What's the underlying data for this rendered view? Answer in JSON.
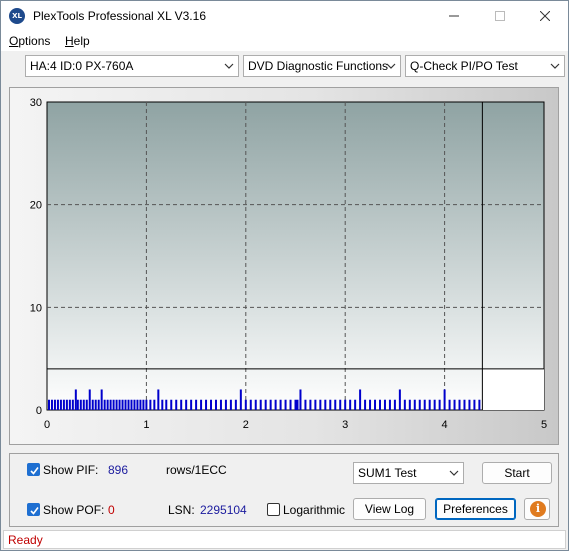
{
  "window": {
    "title": "PlexTools Professional XL V3.16",
    "icon_label": "XL"
  },
  "menu": {
    "items": [
      {
        "label": "Options",
        "accel": "O"
      },
      {
        "label": "Help",
        "accel": "H"
      }
    ]
  },
  "toolbar": {
    "drive": "HA:4 ID:0  PX-760A",
    "function": "DVD Diagnostic Functions",
    "test": "Q-Check PI/PO Test"
  },
  "chart_data": {
    "type": "bar",
    "x_ticks": [
      "0",
      "1",
      "2",
      "3",
      "4",
      "5"
    ],
    "y_ticks": [
      "0",
      "10",
      "20",
      "30"
    ],
    "xlim": [
      0,
      5
    ],
    "ylim": [
      0,
      30
    ],
    "grid": true,
    "threshold_line_y": 4,
    "end_marker_x": 4.38,
    "colors": {
      "bars": "#0000cc",
      "grid": "#555555",
      "plot_top": "#8fa3a3",
      "plot_bottom": "#ffffff"
    },
    "x": [
      0.02,
      0.05,
      0.08,
      0.11,
      0.14,
      0.17,
      0.2,
      0.23,
      0.26,
      0.29,
      0.31,
      0.34,
      0.37,
      0.4,
      0.43,
      0.46,
      0.49,
      0.52,
      0.55,
      0.58,
      0.61,
      0.64,
      0.67,
      0.7,
      0.73,
      0.76,
      0.79,
      0.82,
      0.85,
      0.88,
      0.91,
      0.94,
      0.97,
      1.0,
      1.04,
      1.08,
      1.12,
      1.16,
      1.2,
      1.25,
      1.3,
      1.35,
      1.4,
      1.45,
      1.5,
      1.55,
      1.6,
      1.65,
      1.7,
      1.75,
      1.8,
      1.85,
      1.9,
      1.95,
      2.0,
      2.05,
      2.1,
      2.15,
      2.2,
      2.25,
      2.3,
      2.35,
      2.4,
      2.45,
      2.5,
      2.52,
      2.55,
      2.6,
      2.65,
      2.7,
      2.75,
      2.8,
      2.85,
      2.9,
      2.95,
      3.0,
      3.05,
      3.1,
      3.15,
      3.2,
      3.25,
      3.3,
      3.35,
      3.4,
      3.45,
      3.5,
      3.55,
      3.6,
      3.65,
      3.7,
      3.75,
      3.8,
      3.85,
      3.9,
      3.95,
      4.0,
      4.05,
      4.1,
      4.15,
      4.2,
      4.25,
      4.3,
      4.35
    ],
    "values": [
      1,
      1,
      1,
      1,
      1,
      1,
      1,
      1,
      1,
      2,
      1,
      1,
      1,
      1,
      2,
      1,
      1,
      1,
      2,
      1,
      1,
      1,
      1,
      1,
      1,
      1,
      1,
      1,
      1,
      1,
      1,
      1,
      1,
      1,
      1,
      1,
      2,
      1,
      1,
      1,
      1,
      1,
      1,
      1,
      1,
      1,
      1,
      1,
      1,
      1,
      1,
      1,
      1,
      2,
      1,
      1,
      1,
      1,
      1,
      1,
      1,
      1,
      1,
      1,
      1,
      1,
      2,
      1,
      1,
      1,
      1,
      1,
      1,
      1,
      1,
      1,
      1,
      1,
      2,
      1,
      1,
      1,
      1,
      1,
      1,
      1,
      2,
      1,
      1,
      1,
      1,
      1,
      1,
      1,
      1,
      2,
      1,
      1,
      1,
      1,
      1,
      1,
      1,
      1,
      1,
      1,
      1,
      1,
      2,
      1,
      1,
      1,
      1,
      1,
      1
    ]
  },
  "controls": {
    "show_pif_label": "Show PIF:",
    "pif_value": "896",
    "pif_unit": "rows/1ECC",
    "show_pof_label": "Show POF:",
    "pof_value": "0",
    "lsn_label": "LSN:",
    "lsn_value": "2295104",
    "logarithmic_label": "Logarithmic",
    "test_select": "SUM1 Test",
    "start_label": "Start",
    "view_log_label": "View Log",
    "preferences_label": "Preferences",
    "info_glyph": "i"
  },
  "status": {
    "text": "Ready"
  }
}
